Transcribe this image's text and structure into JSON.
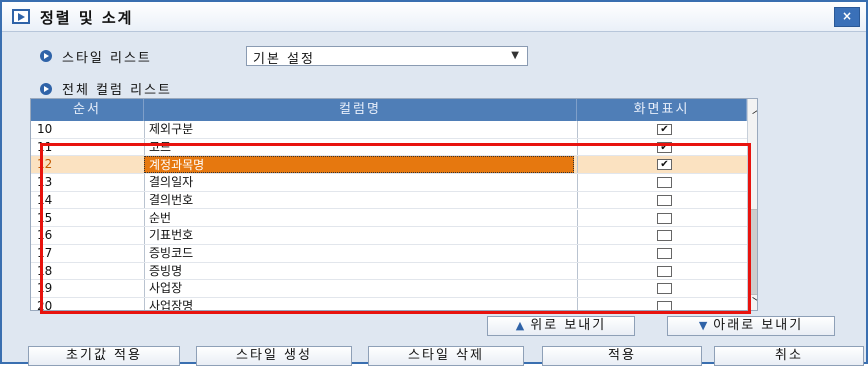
{
  "window": {
    "title": "정렬 및 소계",
    "close_label": "×"
  },
  "style_list": {
    "label": "스타일 리스트",
    "selected": "기본 설정"
  },
  "columns_section": {
    "label": "전체 컬럼 리스트"
  },
  "table": {
    "headers": [
      "순서",
      "컬럼명",
      "화면표시"
    ],
    "rows": [
      {
        "order": "10",
        "name": "제외구분",
        "checked": true
      },
      {
        "order": "11",
        "name": "코드",
        "checked": true
      },
      {
        "order": "12",
        "name": "계정과목명",
        "checked": true,
        "selected": true
      },
      {
        "order": "13",
        "name": "결의일자",
        "checked": false
      },
      {
        "order": "14",
        "name": "결의번호",
        "checked": false
      },
      {
        "order": "15",
        "name": "순번",
        "checked": false
      },
      {
        "order": "16",
        "name": "기표번호",
        "checked": false
      },
      {
        "order": "17",
        "name": "증빙코드",
        "checked": false
      },
      {
        "order": "18",
        "name": "증빙명",
        "checked": false
      },
      {
        "order": "19",
        "name": "사업장",
        "checked": false
      },
      {
        "order": "20",
        "name": "사업장명",
        "checked": false
      }
    ]
  },
  "move_buttons": {
    "up": "위로 보내기",
    "down": "아래로 보내기"
  },
  "footer_buttons": {
    "reset": "초기값 적용",
    "create": "스타일 생성",
    "delete": "스타일 삭제",
    "apply": "적용",
    "cancel": "취소"
  },
  "colors": {
    "header": "#4f7eb7",
    "selected_row": "#fbe2c1",
    "selected_cell": "#e6780f",
    "highlight_box": "#e8130e"
  }
}
